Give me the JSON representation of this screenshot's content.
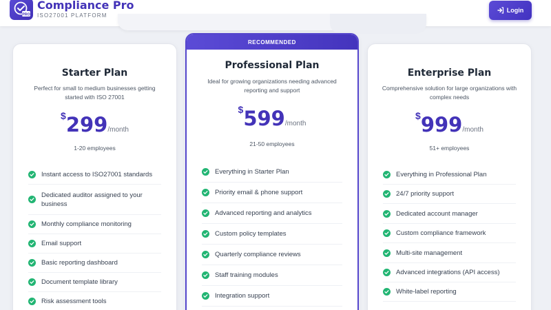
{
  "brand": {
    "title": "Compliance Pro",
    "subtitle": "ISO27001 PLATFORM",
    "logo_text": "PRO",
    "accent_color": "#4333b8"
  },
  "header": {
    "login_label": "Login",
    "login_icon": "login-arrow-icon"
  },
  "plans": [
    {
      "name": "Starter Plan",
      "description": "Perfect for small to medium businesses getting started with ISO 27001",
      "currency": "$",
      "price": "299",
      "period": "/month",
      "employees": "1-20 employees",
      "features": [
        "Instant access to ISO27001 standards",
        "Dedicated auditor assigned to your business",
        "Monthly compliance monitoring",
        "Email support",
        "Basic reporting dashboard",
        "Document template library",
        "Risk assessment tools"
      ]
    },
    {
      "badge": "RECOMMENDED",
      "name": "Professional Plan",
      "description": "Ideal for growing organizations needing advanced reporting and support",
      "currency": "$",
      "price": "599",
      "period": "/month",
      "employees": "21-50 employees",
      "features": [
        "Everything in Starter Plan",
        "Priority email & phone support",
        "Advanced reporting and analytics",
        "Custom policy templates",
        "Quarterly compliance reviews",
        "Staff training modules",
        "Integration support"
      ]
    },
    {
      "name": "Enterprise Plan",
      "description": "Comprehensive solution for large organizations with complex needs",
      "currency": "$",
      "price": "999",
      "period": "/month",
      "employees": "51+ employees",
      "features": [
        "Everything in Professional Plan",
        "24/7 priority support",
        "Dedicated account manager",
        "Custom compliance framework",
        "Multi-site management",
        "Advanced integrations (API access)",
        "White-label reporting"
      ]
    }
  ],
  "colors": {
    "check": "#22b573",
    "recommended_border": "#5546cc"
  }
}
